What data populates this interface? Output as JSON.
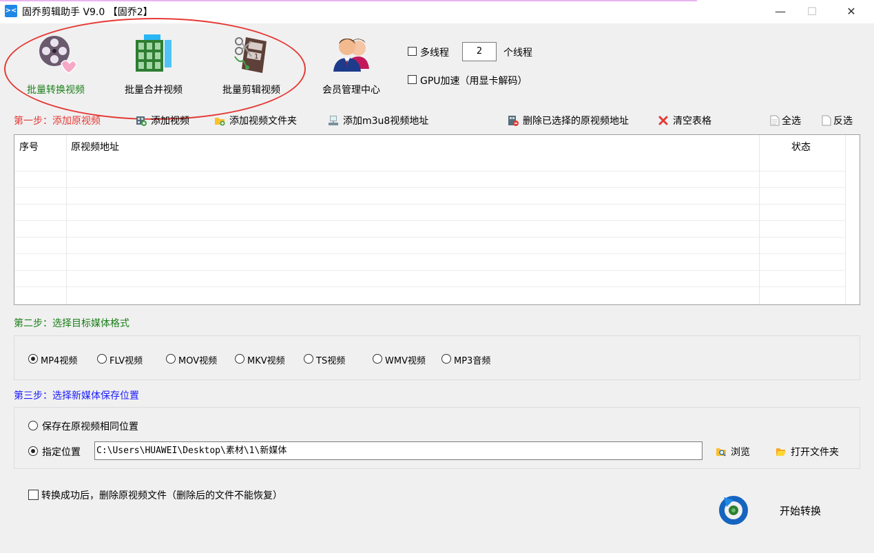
{
  "window": {
    "title": "固乔剪辑助手 V9.0 【固乔2】",
    "app_icon_text": "><",
    "minimize": "—",
    "maximize": "☐",
    "close": "✕"
  },
  "toolbar": {
    "convert": "批量转换视频",
    "merge": "批量合并视频",
    "clip": "批量剪辑视频",
    "member": "会员管理中心",
    "multithread_label": "多线程",
    "thread_count": "2",
    "thread_unit": "个线程",
    "gpu_label": "GPU加速（用显卡解码）",
    "active_color": "#1a7f1a"
  },
  "step1": {
    "label": "第一步：添加原视频",
    "add_video": "添加视频",
    "add_folder": "添加视频文件夹",
    "add_m3u8": "添加m3u8视频地址",
    "delete_selected": "删除已选择的原视频地址",
    "clear_table": "清空表格",
    "select_all": "全选",
    "invert": "反选"
  },
  "table": {
    "columns": [
      "序号",
      "原视频地址",
      "状态"
    ],
    "rows": []
  },
  "step2": {
    "label": "第二步：选择目标媒体格式",
    "formats": [
      "MP4视频",
      "FLV视频",
      "MOV视频",
      "MKV视频",
      "TS视频",
      "WMV视频",
      "MP3音频"
    ],
    "selected": "MP4视频"
  },
  "step3": {
    "label": "第三步：选择新媒体保存位置",
    "same_location": "保存在原视频相同位置",
    "custom_location": "指定位置",
    "path": "C:\\Users\\HUAWEI\\Desktop\\素材\\1\\新媒体",
    "browse": "浏览",
    "open_folder": "打开文件夹"
  },
  "footer": {
    "delete_after": "转换成功后，删除原视频文件（删除后的文件不能恢复）",
    "start": "开始转换"
  },
  "colors": {
    "step1": "#e53935",
    "step2": "#1a7f1a",
    "step3": "#1a1aff",
    "highlight": "#e53935"
  }
}
